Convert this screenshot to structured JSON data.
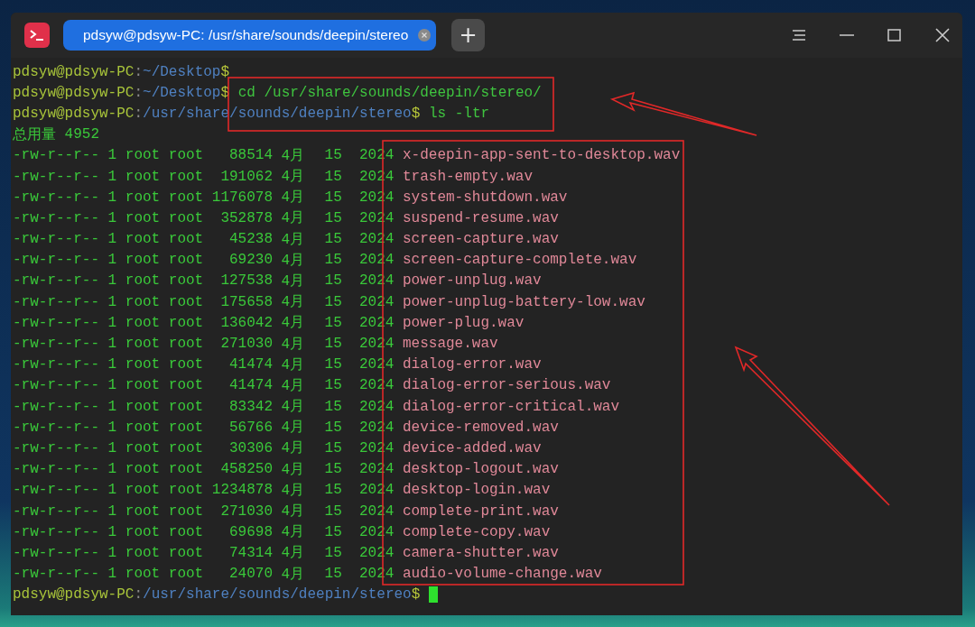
{
  "window": {
    "tab": {
      "title": "pdsyw@pdsyw-PC: /usr/share/sounds/deepin/stereo",
      "selected": true
    },
    "new_tab": "+"
  },
  "terminal": {
    "lines": [
      {
        "kind": "prompt",
        "user": "pdsyw@pdsyw-PC",
        "separator": ":",
        "path": "~/Desktop",
        "symbol": "$"
      },
      {
        "kind": "prompt",
        "user": "pdsyw@pdsyw-PC",
        "separator": ":",
        "path": "~/Desktop",
        "symbol": "$",
        "command": "cd /usr/share/sounds/deepin/stereo/"
      },
      {
        "kind": "prompt",
        "user": "pdsyw@pdsyw-PC",
        "separator": ":",
        "path": "/usr/share/sounds/deepin/stereo",
        "symbol": "$",
        "command": "ls -ltr"
      },
      {
        "kind": "total",
        "label": "总用量",
        "value": "4952"
      },
      {
        "kind": "file",
        "perms": "-rw-r--r--",
        "links": "1",
        "owner": "root",
        "group": "root",
        "bytes": "88514",
        "month": "4月",
        "day": "15",
        "year": "2024",
        "name": "x-deepin-app-sent-to-desktop.wav"
      },
      {
        "kind": "file",
        "perms": "-rw-r--r--",
        "links": "1",
        "owner": "root",
        "group": "root",
        "bytes": "191062",
        "month": "4月",
        "day": "15",
        "year": "2024",
        "name": "trash-empty.wav"
      },
      {
        "kind": "file",
        "perms": "-rw-r--r--",
        "links": "1",
        "owner": "root",
        "group": "root",
        "bytes": "1176078",
        "month": "4月",
        "day": "15",
        "year": "2024",
        "name": "system-shutdown.wav"
      },
      {
        "kind": "file",
        "perms": "-rw-r--r--",
        "links": "1",
        "owner": "root",
        "group": "root",
        "bytes": "352878",
        "month": "4月",
        "day": "15",
        "year": "2024",
        "name": "suspend-resume.wav"
      },
      {
        "kind": "file",
        "perms": "-rw-r--r--",
        "links": "1",
        "owner": "root",
        "group": "root",
        "bytes": "45238",
        "month": "4月",
        "day": "15",
        "year": "2024",
        "name": "screen-capture.wav"
      },
      {
        "kind": "file",
        "perms": "-rw-r--r--",
        "links": "1",
        "owner": "root",
        "group": "root",
        "bytes": "69230",
        "month": "4月",
        "day": "15",
        "year": "2024",
        "name": "screen-capture-complete.wav"
      },
      {
        "kind": "file",
        "perms": "-rw-r--r--",
        "links": "1",
        "owner": "root",
        "group": "root",
        "bytes": "127538",
        "month": "4月",
        "day": "15",
        "year": "2024",
        "name": "power-unplug.wav"
      },
      {
        "kind": "file",
        "perms": "-rw-r--r--",
        "links": "1",
        "owner": "root",
        "group": "root",
        "bytes": "175658",
        "month": "4月",
        "day": "15",
        "year": "2024",
        "name": "power-unplug-battery-low.wav"
      },
      {
        "kind": "file",
        "perms": "-rw-r--r--",
        "links": "1",
        "owner": "root",
        "group": "root",
        "bytes": "136042",
        "month": "4月",
        "day": "15",
        "year": "2024",
        "name": "power-plug.wav"
      },
      {
        "kind": "file",
        "perms": "-rw-r--r--",
        "links": "1",
        "owner": "root",
        "group": "root",
        "bytes": "271030",
        "month": "4月",
        "day": "15",
        "year": "2024",
        "name": "message.wav"
      },
      {
        "kind": "file",
        "perms": "-rw-r--r--",
        "links": "1",
        "owner": "root",
        "group": "root",
        "bytes": "41474",
        "month": "4月",
        "day": "15",
        "year": "2024",
        "name": "dialog-error.wav"
      },
      {
        "kind": "file",
        "perms": "-rw-r--r--",
        "links": "1",
        "owner": "root",
        "group": "root",
        "bytes": "41474",
        "month": "4月",
        "day": "15",
        "year": "2024",
        "name": "dialog-error-serious.wav"
      },
      {
        "kind": "file",
        "perms": "-rw-r--r--",
        "links": "1",
        "owner": "root",
        "group": "root",
        "bytes": "83342",
        "month": "4月",
        "day": "15",
        "year": "2024",
        "name": "dialog-error-critical.wav"
      },
      {
        "kind": "file",
        "perms": "-rw-r--r--",
        "links": "1",
        "owner": "root",
        "group": "root",
        "bytes": "56766",
        "month": "4月",
        "day": "15",
        "year": "2024",
        "name": "device-removed.wav"
      },
      {
        "kind": "file",
        "perms": "-rw-r--r--",
        "links": "1",
        "owner": "root",
        "group": "root",
        "bytes": "30306",
        "month": "4月",
        "day": "15",
        "year": "2024",
        "name": "device-added.wav"
      },
      {
        "kind": "file",
        "perms": "-rw-r--r--",
        "links": "1",
        "owner": "root",
        "group": "root",
        "bytes": "458250",
        "month": "4月",
        "day": "15",
        "year": "2024",
        "name": "desktop-logout.wav"
      },
      {
        "kind": "file",
        "perms": "-rw-r--r--",
        "links": "1",
        "owner": "root",
        "group": "root",
        "bytes": "1234878",
        "month": "4月",
        "day": "15",
        "year": "2024",
        "name": "desktop-login.wav"
      },
      {
        "kind": "file",
        "perms": "-rw-r--r--",
        "links": "1",
        "owner": "root",
        "group": "root",
        "bytes": "271030",
        "month": "4月",
        "day": "15",
        "year": "2024",
        "name": "complete-print.wav"
      },
      {
        "kind": "file",
        "perms": "-rw-r--r--",
        "links": "1",
        "owner": "root",
        "group": "root",
        "bytes": "69698",
        "month": "4月",
        "day": "15",
        "year": "2024",
        "name": "complete-copy.wav"
      },
      {
        "kind": "file",
        "perms": "-rw-r--r--",
        "links": "1",
        "owner": "root",
        "group": "root",
        "bytes": "74314",
        "month": "4月",
        "day": "15",
        "year": "2024",
        "name": "camera-shutter.wav"
      },
      {
        "kind": "file",
        "perms": "-rw-r--r--",
        "links": "1",
        "owner": "root",
        "group": "root",
        "bytes": "24070",
        "month": "4月",
        "day": "15",
        "year": "2024",
        "name": "audio-volume-change.wav"
      },
      {
        "kind": "prompt",
        "user": "pdsyw@pdsyw-PC",
        "separator": ":",
        "path": "/usr/share/sounds/deepin/stereo",
        "symbol": "$",
        "cursor": true
      }
    ]
  }
}
